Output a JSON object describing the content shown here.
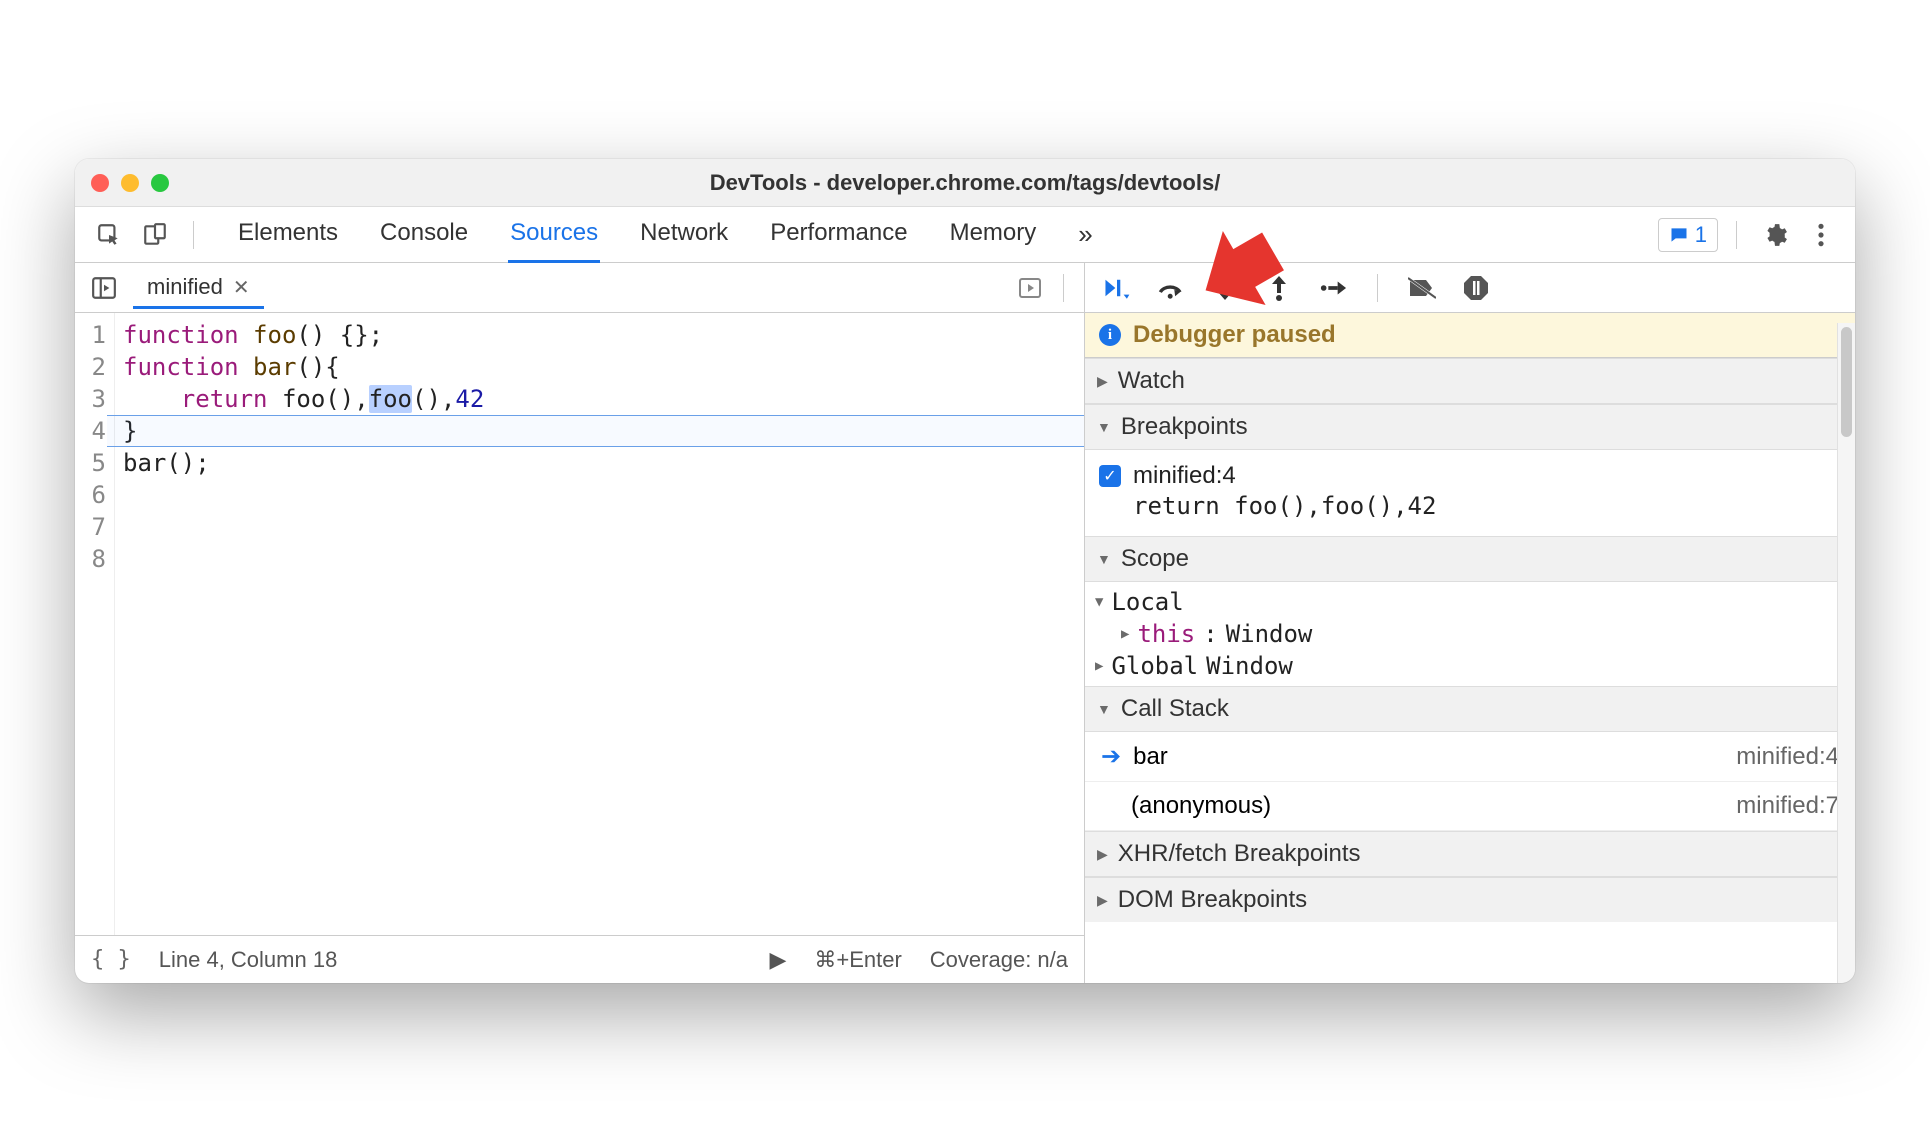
{
  "window": {
    "title": "DevTools - developer.chrome.com/tags/devtools/"
  },
  "toolbar": {
    "tabs": [
      "Elements",
      "Console",
      "Sources",
      "Network",
      "Performance",
      "Memory"
    ],
    "activeTab": "Sources",
    "moreGlyph": "»",
    "issuesCount": "1"
  },
  "file": {
    "name": "minified"
  },
  "code": {
    "lines": [
      {
        "n": "1",
        "segments": [
          {
            "t": "function ",
            "c": "kw"
          },
          {
            "t": "foo",
            "c": "fn"
          },
          {
            "t": "() {};",
            "c": "id"
          }
        ]
      },
      {
        "n": "2",
        "segments": []
      },
      {
        "n": "3",
        "segments": [
          {
            "t": "function ",
            "c": "kw"
          },
          {
            "t": "bar",
            "c": "fn"
          },
          {
            "t": "(){",
            "c": "id"
          }
        ]
      },
      {
        "n": "4",
        "segments": [
          {
            "t": "    ",
            "c": "id"
          },
          {
            "t": "return ",
            "c": "kw"
          },
          {
            "t": "foo(),",
            "c": "id"
          },
          {
            "t": "foo",
            "c": "id",
            "sel": true
          },
          {
            "t": "(),",
            "c": "id"
          },
          {
            "t": "42",
            "c": "num"
          }
        ]
      },
      {
        "n": "5",
        "segments": [
          {
            "t": "}",
            "c": "id"
          }
        ]
      },
      {
        "n": "6",
        "segments": []
      },
      {
        "n": "7",
        "segments": [
          {
            "t": "bar();",
            "c": "id"
          }
        ]
      },
      {
        "n": "8",
        "segments": []
      }
    ],
    "highlightLineIndex": 3
  },
  "status": {
    "cursor": "Line 4, Column 18",
    "runHint": "⌘+Enter",
    "coverage": "Coverage: n/a"
  },
  "debugger": {
    "statusText": "Debugger paused",
    "panes": {
      "watch": {
        "title": "Watch",
        "expanded": false
      },
      "breakpoints": {
        "title": "Breakpoints",
        "expanded": true,
        "items": [
          {
            "checked": true,
            "label": "minified:4",
            "code": "return foo(),foo(),42"
          }
        ]
      },
      "scope": {
        "title": "Scope",
        "expanded": true,
        "local": {
          "label": "Local",
          "this": "this",
          "thisVal": "Window"
        },
        "global": {
          "label": "Global",
          "val": "Window"
        }
      },
      "callstack": {
        "title": "Call Stack",
        "expanded": true,
        "frames": [
          {
            "name": "bar",
            "loc": "minified:4",
            "current": true
          },
          {
            "name": "(anonymous)",
            "loc": "minified:7",
            "current": false
          }
        ]
      },
      "xhr": {
        "title": "XHR/fetch Breakpoints",
        "expanded": false
      },
      "dom": {
        "title": "DOM Breakpoints",
        "expanded": false
      }
    }
  }
}
